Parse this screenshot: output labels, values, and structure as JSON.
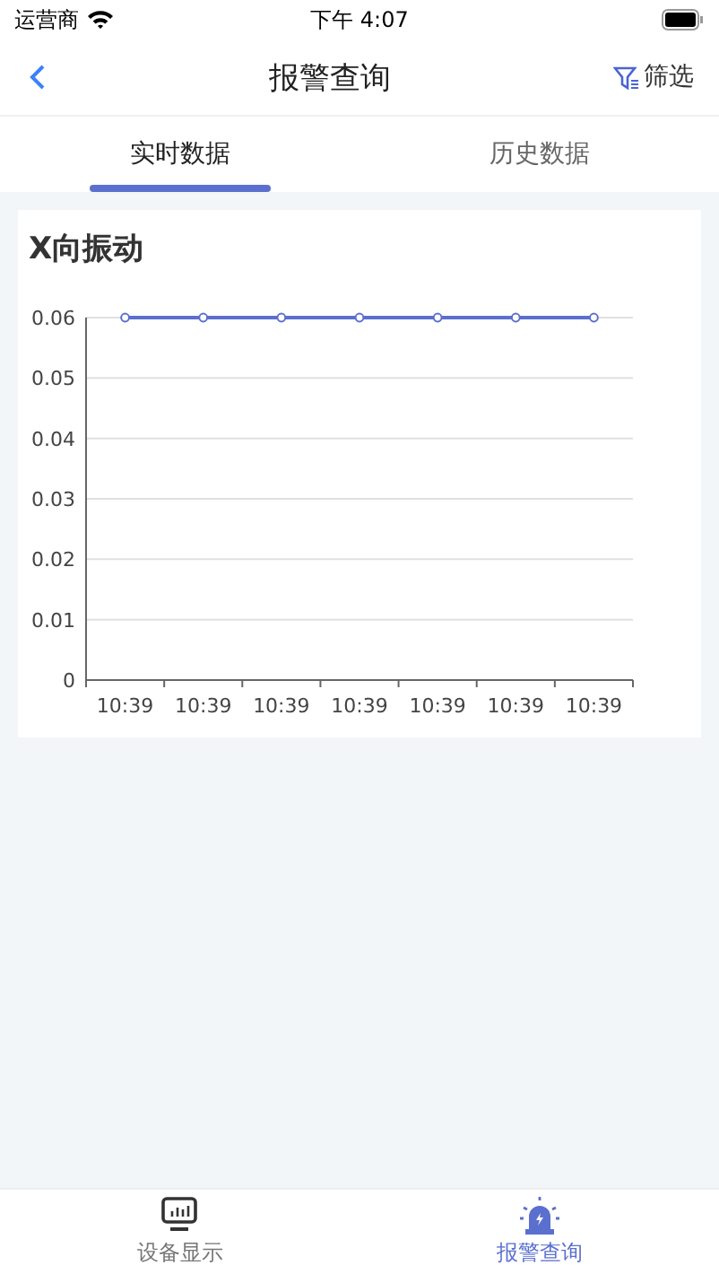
{
  "status_bar": {
    "carrier": "运营商",
    "time": "下午 4:07"
  },
  "nav": {
    "title": "报警查询",
    "filter_label": "筛选"
  },
  "tabs": [
    {
      "label": "实时数据",
      "selected": true
    },
    {
      "label": "历史数据",
      "selected": false
    }
  ],
  "chart_card": {
    "title": "X向振动",
    "chart_data": {
      "type": "line",
      "categories": [
        "10:39",
        "10:39",
        "10:39",
        "10:39",
        "10:39",
        "10:39",
        "10:39"
      ],
      "grid": true,
      "series": [
        {
          "color": "#5b6fcf",
          "marker": "circle",
          "values": [
            0.06,
            0.06,
            0.06,
            0.06,
            0.06,
            0.06,
            0.06
          ]
        }
      ],
      "ylim": [
        0,
        0.06
      ],
      "yticks": [
        {
          "value": 0,
          "label": "0"
        },
        {
          "value": 0.01,
          "label": "0.01"
        },
        {
          "value": 0.02,
          "label": "0.02"
        },
        {
          "value": 0.03,
          "label": "0.03"
        },
        {
          "value": 0.04,
          "label": "0.04"
        },
        {
          "value": 0.05,
          "label": "0.05"
        },
        {
          "value": 0.06,
          "label": "0.06"
        }
      ]
    }
  },
  "bottom_tabs": [
    {
      "kind": "monitor",
      "label": "设备显示",
      "selected": false
    },
    {
      "kind": "alarm",
      "label": "报警查询",
      "selected": true
    }
  ]
}
